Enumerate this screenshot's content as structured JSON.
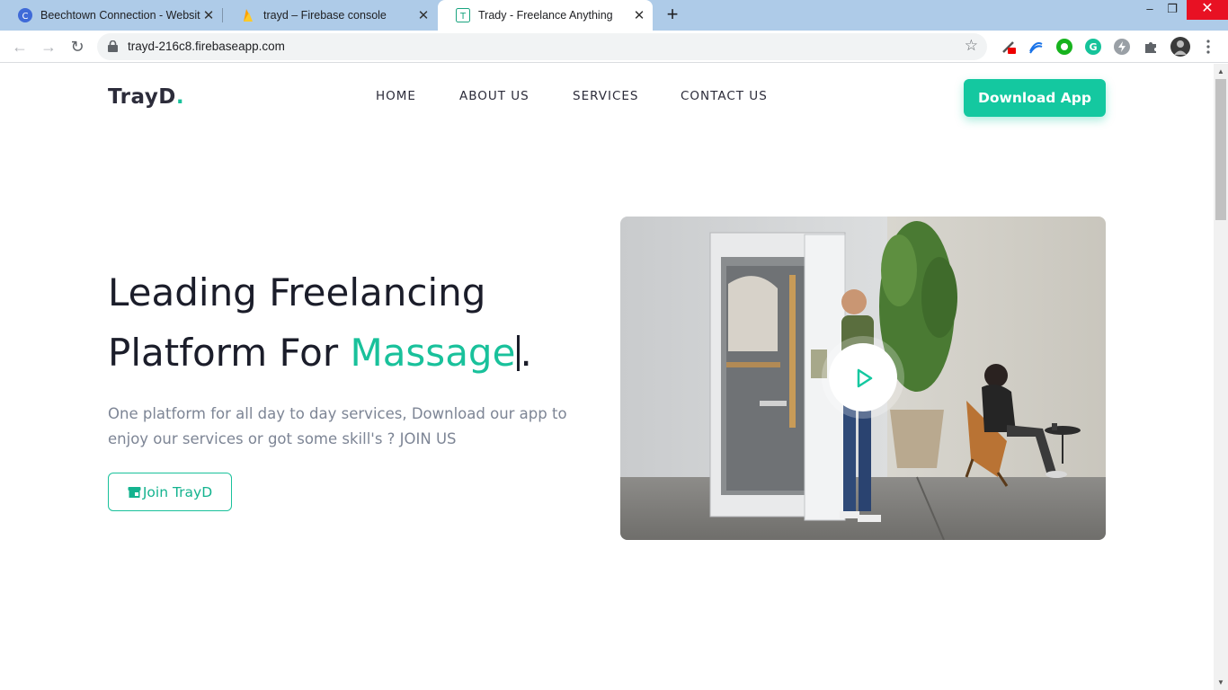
{
  "browser": {
    "tabs": [
      {
        "title": "Beechtown Connection - Website",
        "favicon": "c-circle-icon",
        "active": false
      },
      {
        "title": "trayd – Firebase console",
        "favicon": "firebase-icon",
        "active": false
      },
      {
        "title": "Trady - Freelance Anything",
        "favicon": "t-square-icon",
        "active": true
      }
    ],
    "new_tab": "+",
    "url": "trayd-216c8.firebaseapp.com",
    "window_controls": {
      "minimize": "–",
      "restore": "❐",
      "close": "✕"
    },
    "nav": {
      "back": "←",
      "forward": "→",
      "reload": "↻"
    },
    "bookmark": "☆",
    "extensions": [
      "pen-extension-icon",
      "wave-extension-icon",
      "green-circle-extension-icon",
      "grammarly-icon",
      "bolt-extension-icon",
      "puzzle-icon",
      "profile-avatar",
      "menu-icon"
    ]
  },
  "site": {
    "logo": {
      "text": "TrayD",
      "dot": "."
    },
    "nav": [
      "HOME",
      "ABOUT US",
      "SERVICES",
      "CONTACT US"
    ],
    "download_button": "Download App",
    "hero": {
      "title_line1": "Leading Freelancing",
      "title_line2_prefix": "Platform For ",
      "title_line2_highlight": "Massage",
      "title_line2_suffix": ".",
      "description": "One platform for all day to day services, Download our app to enjoy our services or got some skill's ? JOIN US",
      "join_button": "Join TrayD"
    },
    "colors": {
      "accent": "#14c8a0",
      "heading": "#1b1d2a",
      "body_text": "#7d8595"
    }
  }
}
